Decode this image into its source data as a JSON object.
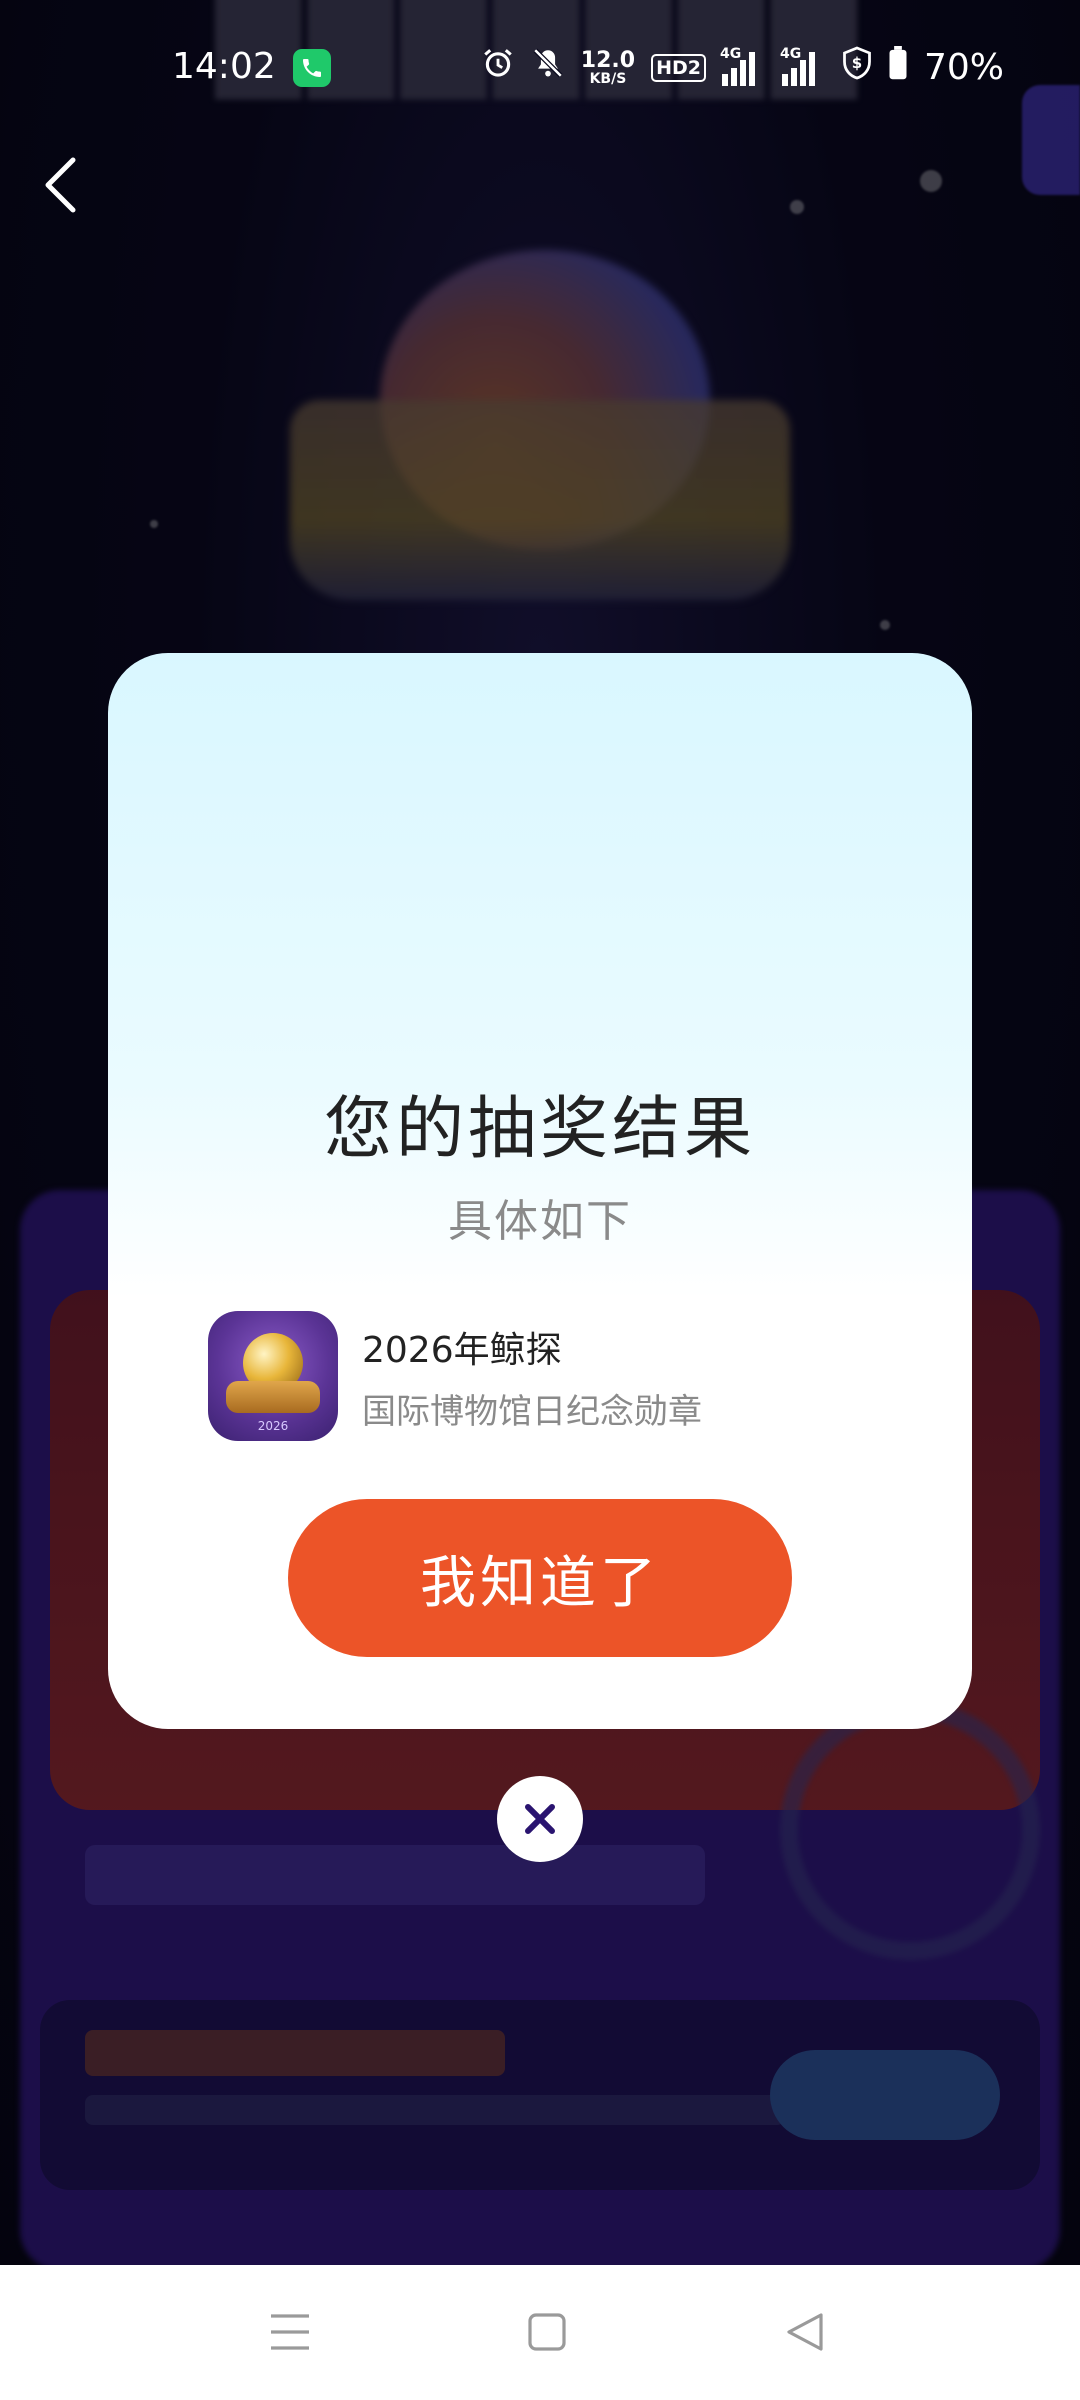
{
  "status_bar": {
    "time": "14:02",
    "network_speed_value": "12.0",
    "network_speed_unit": "KB/S",
    "hd_label": "HD2",
    "sim1_label": "4G",
    "sim2_label": "4G",
    "battery": "70%",
    "icons": [
      "phone-call-icon",
      "alarm-icon",
      "mute-icon",
      "signal-icon",
      "signal-icon",
      "vpn-shield-icon",
      "battery-icon"
    ]
  },
  "dialog": {
    "title": "您的抽奖结果",
    "subtitle": "具体如下",
    "prize": {
      "name": "2026年鲸探",
      "description": "国际博物馆日纪念勋章",
      "thumb_caption": "2026"
    },
    "confirm_label": "我知道了"
  },
  "colors": {
    "accent": "#EC5428",
    "dialog_top": "#D9F7FF",
    "background": "#07061A"
  }
}
